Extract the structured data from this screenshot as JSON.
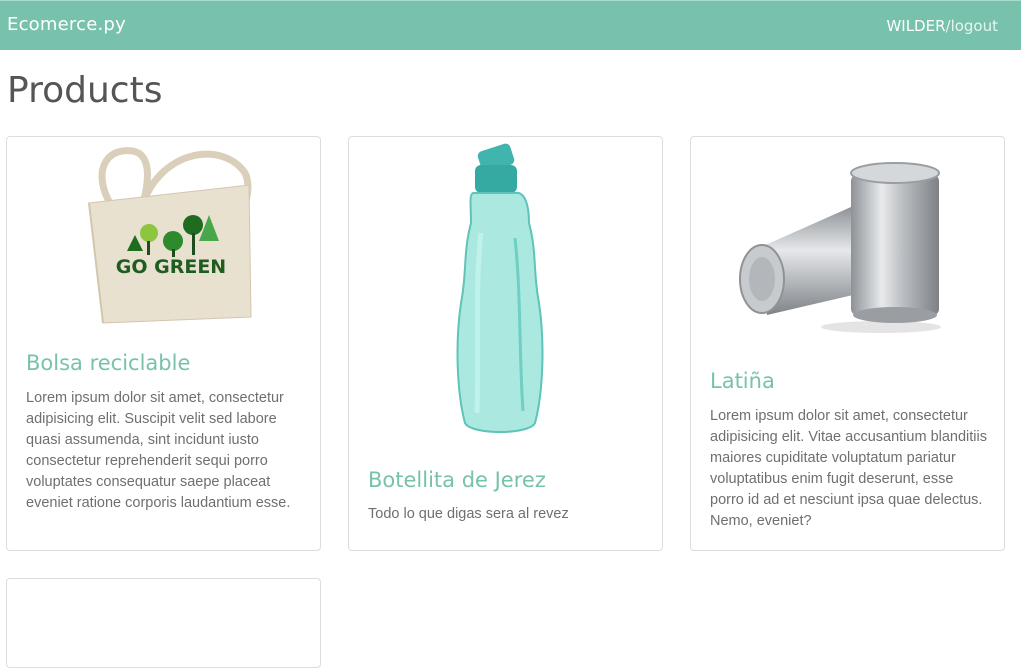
{
  "navbar": {
    "brand": "Ecomerce.py",
    "username": "WILDER",
    "separator": "/",
    "logout": "logout"
  },
  "page": {
    "title": "Products"
  },
  "products": [
    {
      "name": "Bolsa reciclable",
      "description": "Lorem ipsum dolor sit amet, consectetur adipisicing elit. Suscipit velit sed labore quasi assumenda, sint incidunt iusto consectetur reprehenderit sequi porro voluptates consequatur saepe placeat eveniet ratione corporis laudantium esse.",
      "image_icon": "tote-bag-icon",
      "image_text": "GO GREEN"
    },
    {
      "name": "Botellita de Jerez",
      "description": "Todo lo que digas sera al revez",
      "image_icon": "water-bottle-icon"
    },
    {
      "name": "Latiña",
      "description": "Lorem ipsum dolor sit amet, consectetur adipisicing elit. Vitae accusantium blanditiis maiores cupiditate voluptatum pariatur voluptatibus enim fugit deserunt, esse porro id ad et nesciunt ipsa quae delectus. Nemo, eveniet?",
      "image_icon": "cans-icon"
    }
  ],
  "colors": {
    "navbar": "#78c2ad",
    "accent": "#78c2ad",
    "text": "#6f6f6f",
    "heading": "#555555"
  }
}
